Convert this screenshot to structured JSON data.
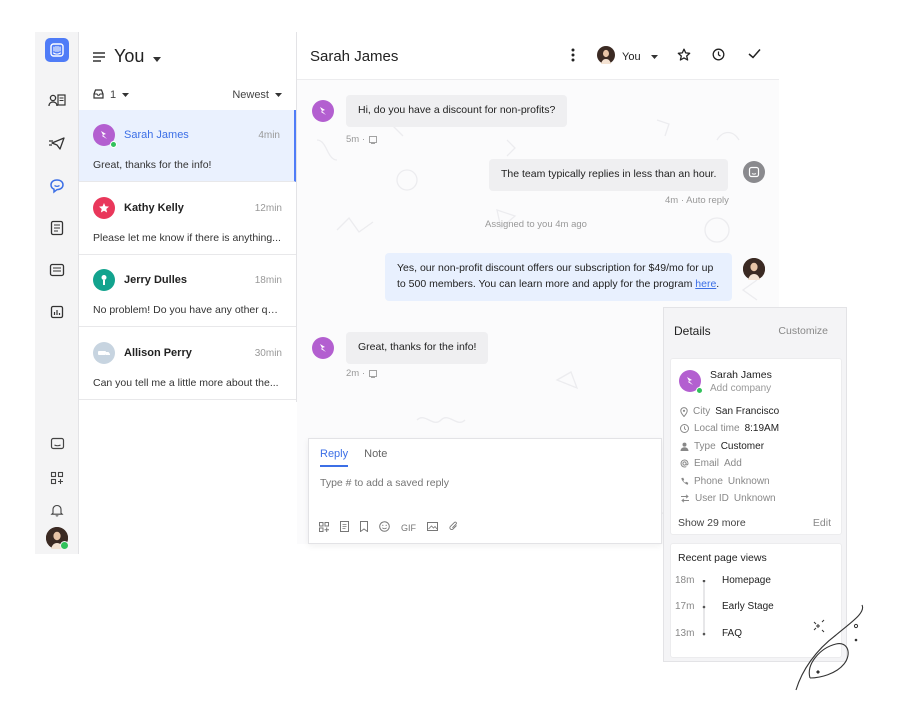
{
  "inbox": {
    "title": "You",
    "filter_count": "1",
    "sort": "Newest",
    "conversations": [
      {
        "name": "Sarah James",
        "time": "4min",
        "preview": "Great, thanks for the info!",
        "avatar_color": "#b35fd0"
      },
      {
        "name": "Kathy Kelly",
        "time": "12min",
        "preview": "Please let me know if there is anything...",
        "avatar_color": "#e9375b"
      },
      {
        "name": "Jerry Dulles",
        "time": "18min",
        "preview": "No problem! Do you have any other qu...",
        "avatar_color": "#12a38e"
      },
      {
        "name": "Allison Perry",
        "time": "30min",
        "preview": "Can you tell me a little more about the...",
        "avatar_color": "#b8c9d9"
      }
    ]
  },
  "conversation": {
    "title": "Sarah James",
    "assignee": "You",
    "messages": {
      "m1": {
        "text": "Hi, do you have a discount for non-profits?",
        "meta": "5m ·"
      },
      "m2": {
        "text": "The team typically replies in less than an hour.",
        "meta": "4m · Auto reply"
      },
      "system": "Assigned to you 4m ago",
      "m3_part1": "Yes, our non-profit discount offers our subscription for $49/mo for up to 500 members. You can learn more and apply for the program ",
      "m3_link": "here",
      "m3_end": ".",
      "m4": {
        "text": "Great, thanks for the info!",
        "meta": "2m ·"
      }
    }
  },
  "composer": {
    "tab_reply": "Reply",
    "tab_note": "Note",
    "placeholder": "Type # to add a saved reply",
    "gif": "GIF"
  },
  "details": {
    "title": "Details",
    "customize": "Customize",
    "contact_name": "Sarah James",
    "add_company": "Add company",
    "city_label": "City",
    "city_value": "San Francisco",
    "local_time_label": "Local time",
    "local_time_value": "8:19AM",
    "type_label": "Type",
    "type_value": "Customer",
    "email_label": "Email",
    "email_value": "Add",
    "phone_label": "Phone",
    "phone_value": "Unknown",
    "user_id_label": "User ID",
    "user_id_value": "Unknown",
    "show_more": "Show 29 more",
    "edit": "Edit",
    "recent_title": "Recent page views",
    "views": [
      {
        "time": "18m",
        "page": "Homepage"
      },
      {
        "time": "17m",
        "page": "Early Stage"
      },
      {
        "time": "13m",
        "page": "FAQ"
      }
    ]
  },
  "colors": {
    "accent": "#4f7cf7",
    "online": "#31c15b",
    "agent_bubble": "#e8f0fe"
  },
  "icons": [
    "intercom-logo-icon",
    "contacts-icon",
    "outbound-icon",
    "inbox-chat-icon",
    "articles-icon",
    "messages-icon",
    "reports-icon",
    "messenger-icon",
    "apps-icon",
    "notifications-icon",
    "user-avatar-icon"
  ]
}
